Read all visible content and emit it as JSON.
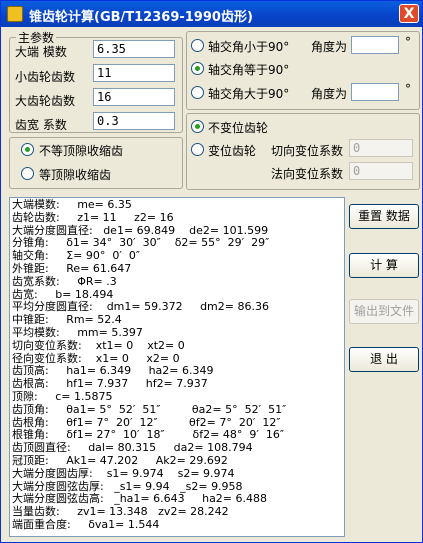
{
  "window": {
    "title": "锥齿轮计算(GB/T12369-1990齿形)",
    "close_glyph": "X"
  },
  "main_params": {
    "legend": "主参数",
    "module_label": "大端  模数",
    "module_value": "6.35",
    "z1_label": "小齿轮齿数",
    "z1_value": "11",
    "z2_label": "大齿轮齿数",
    "z2_value": "16",
    "width_label": "齿宽  系数",
    "width_value": "0.3"
  },
  "shaft_angle": {
    "opt1": "轴交角小于90°",
    "opt2": "轴交角等于90°",
    "opt3": "轴交角大于90°",
    "angle_label": "角度为",
    "degree_mark": "°",
    "selected": 2
  },
  "clearance": {
    "opt1": "不等顶隙收缩齿",
    "opt2": "等顶隙收缩齿",
    "selected": 1
  },
  "shift": {
    "opt1": "不变位齿轮",
    "opt2": "变位齿轮",
    "selected": 1,
    "tangential_label": "切向变位系数",
    "tangential_value": "0",
    "normal_label": "法向变位系数",
    "normal_value": "0"
  },
  "buttons": {
    "reset": "重置  数据",
    "calc": "计      算",
    "export": "输出到文件",
    "exit": "退      出"
  },
  "output_lines": [
    "大端模数:     me= 6.35",
    "齿轮齿数:     z1= 11     z2= 16",
    "大端分度圆直径:   de1= 69.849    de2= 101.599",
    "分锥角:     δ1= 34°  30′  30″    δ2= 55°  29′  29″",
    "轴交角:     Σ= 90°  0′  0″",
    "外锥距:     Re= 61.647",
    "齿宽系数:     ΦR= .3",
    "齿宽:     b= 18.494",
    "平均分度圆直径:    dm1= 59.372     dm2= 86.36",
    "中锥距:     Rm= 52.4",
    "平均模数:     mm= 5.397",
    "切向变位系数:    xt1= 0    xt2= 0",
    "径向变位系数:    x1= 0     x2= 0",
    "齿顶高:     ha1= 6.349     ha2= 6.349",
    "齿根高:     hf1= 7.937     hf2= 7.937",
    "顶隙:     c= 1.5875",
    "齿顶角:     θa1= 5°  52′  51″         θa2= 5°  52′  51″",
    "齿根角:     θf1= 7°  20′  12″         θf2= 7°  20′  12″",
    "根锥角:     δf1= 27°  10′  18″        δf2= 48°  9′  16″",
    "齿顶圆直径:     dal= 80.315     da2= 108.794",
    "冠顶距:     Ak1= 47.202     Ak2= 29.692",
    "大端分度圆齿厚:    s1= 9.974    s2= 9.974",
    "大端分度圆弦齿厚:   _s1= 9.94   _s2= 9.958",
    "大端分度圆弦齿高:   _ha1= 6.643     ha2= 6.488",
    "当量齿数:     zv1= 13.348   zv2= 28.242",
    "端面重合度:     δva1= 1.544"
  ]
}
